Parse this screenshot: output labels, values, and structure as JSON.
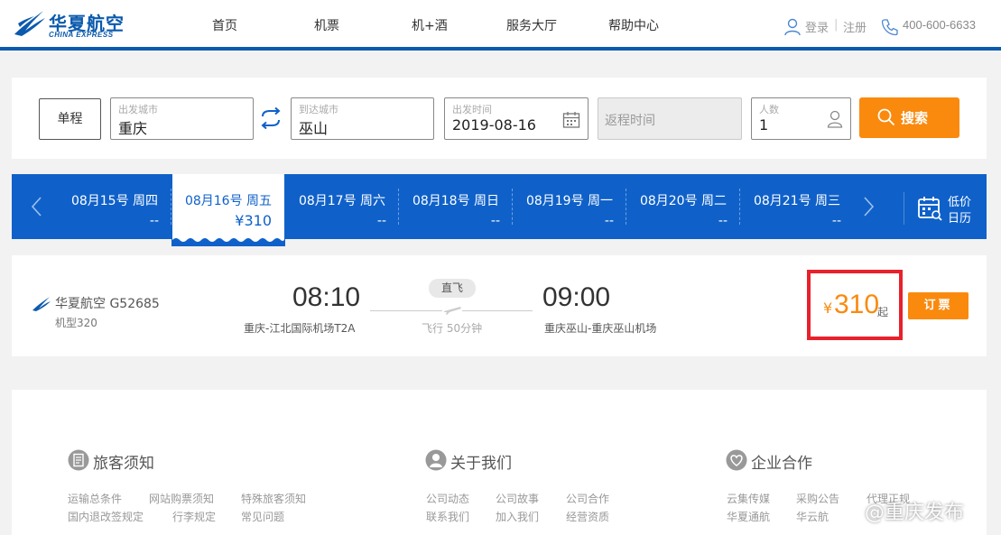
{
  "header": {
    "brand_cn": "华夏航空",
    "brand_en": "CHINA EXPRESS",
    "nav": [
      "首页",
      "机票",
      "机+酒",
      "服务大厅",
      "帮助中心"
    ],
    "login": "登录",
    "separator": "|",
    "register": "注册",
    "phone": "400-600-6633",
    "accent_color": "#0b5aad"
  },
  "search": {
    "trip_type": "单程",
    "depart_label": "出发城市",
    "depart_value": "重庆",
    "arrive_label": "到达城市",
    "arrive_value": "巫山",
    "date_label": "出发时间",
    "date_value": "2019-08-16",
    "return_placeholder": "返程时间",
    "people_label": "人数",
    "people_value": "1",
    "search_button": "搜索",
    "button_color": "#f98a0e"
  },
  "dates": [
    {
      "date": "08月15号 周四",
      "price": "--"
    },
    {
      "date": "08月16号 周五",
      "price": "¥310",
      "active": true
    },
    {
      "date": "08月17号 周六",
      "price": "--"
    },
    {
      "date": "08月18号 周日",
      "price": "--"
    },
    {
      "date": "08月19号 周一",
      "price": "--"
    },
    {
      "date": "08月20号 周二",
      "price": "--"
    },
    {
      "date": "08月21号 周三",
      "price": "--"
    }
  ],
  "calendar": {
    "line1": "低价",
    "line2": "日历"
  },
  "flight": {
    "airline": "华夏航空 G52685",
    "aircraft": "机型320",
    "depart_time": "08:10",
    "depart_airport": "重庆-江北国际机场T2A",
    "badge": "直飞",
    "duration": "飞行 50分钟",
    "arrive_time": "09:00",
    "arrive_airport": "重庆巫山-重庆巫山机场",
    "currency": "¥",
    "price": "310",
    "price_suffix": "起",
    "book_button": "订票",
    "highlight_color": "#e8212c"
  },
  "footer": {
    "sections": [
      {
        "title": "旅客须知",
        "icon": "document-icon"
      },
      {
        "title": "关于我们",
        "icon": "person-icon"
      },
      {
        "title": "企业合作",
        "icon": "heart-icon"
      }
    ],
    "links": {
      "col1_row1": [
        "运输总条件",
        "网站购票须知",
        "特殊旅客须知"
      ],
      "col1_row2": [
        "国内退改签规定",
        "行李规定",
        "常见问题"
      ],
      "col2_row1": [
        "公司动态",
        "公司故事",
        "公司合作"
      ],
      "col2_row2": [
        "联系我们",
        "加入我们",
        "经营资质"
      ],
      "col3_row1": [
        "云集传媒",
        "采购公告",
        "代理正规"
      ],
      "col3_row2": [
        "华夏通航",
        "华云航"
      ]
    }
  },
  "watermark": "@重庆发布"
}
